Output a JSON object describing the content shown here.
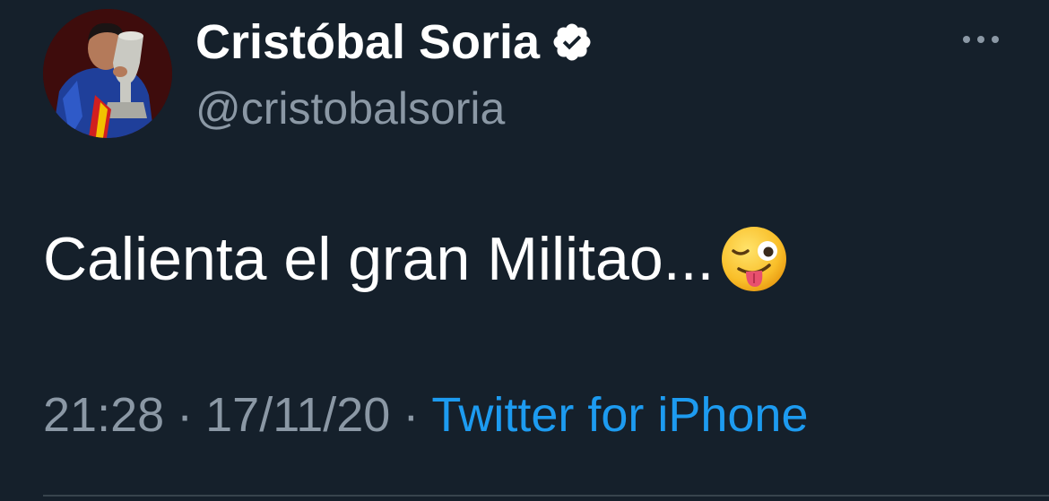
{
  "tweet": {
    "author": {
      "display_name": "Cristóbal Soria",
      "handle": "@cristobalsoria",
      "verified": true
    },
    "text": "Calienta el gran Militao...",
    "emoji": "winking-face-with-tongue",
    "time": "21:28",
    "date": "17/11/20",
    "separator": "·",
    "source": "Twitter for iPhone"
  },
  "icons": {
    "avatar": "profile-photo",
    "verified": "verified-badge-icon",
    "more": "more-options-icon"
  },
  "colors": {
    "background": "#15202b",
    "text_primary": "#ffffff",
    "text_secondary": "#8b98a5",
    "link": "#1d9bf0",
    "divider": "#38444d"
  }
}
